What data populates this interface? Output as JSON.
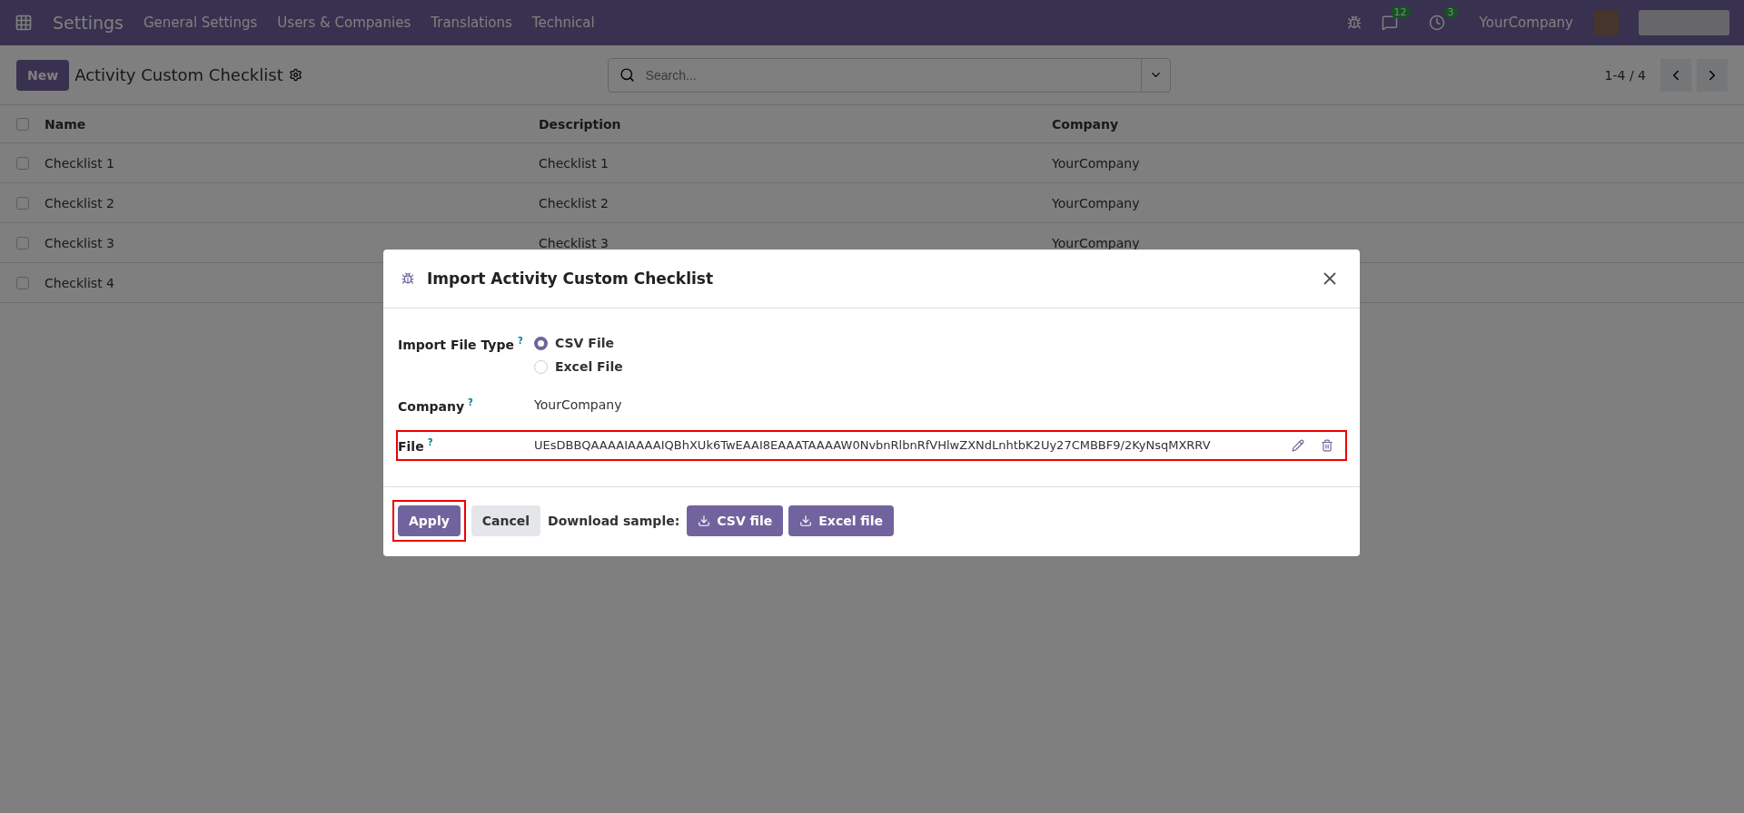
{
  "navbar": {
    "app": "Settings",
    "menu": [
      "General Settings",
      "Users & Companies",
      "Translations",
      "Technical"
    ],
    "messages_count": "12",
    "activities_count": "3",
    "company": "YourCompany"
  },
  "control_panel": {
    "new_button": "New",
    "title": "Activity Custom Checklist",
    "search": {
      "placeholder": "Search..."
    },
    "pager": "1-4 / 4"
  },
  "table": {
    "columns": [
      "Name",
      "Description",
      "Company"
    ],
    "rows": [
      {
        "cells": [
          "Checklist 1",
          "Checklist 1",
          "YourCompany"
        ],
        "checked": false
      },
      {
        "cells": [
          "Checklist 2",
          "Checklist 2",
          "YourCompany"
        ],
        "checked": false
      },
      {
        "cells": [
          "Checklist 3",
          "Checklist 3",
          "YourCompany"
        ],
        "checked": false
      },
      {
        "cells": [
          "Checklist 4"
        ],
        "checked": false
      }
    ],
    "all_checked": false
  },
  "dialog": {
    "title": "Import Activity Custom Checklist",
    "import_type": {
      "label": "Import File Type",
      "help": "?",
      "options": [
        {
          "label": "CSV File",
          "selected": true
        },
        {
          "label": "Excel File",
          "selected": false
        }
      ]
    },
    "company": {
      "label": "Company",
      "help": "?",
      "value": "YourCompany"
    },
    "file": {
      "label": "File",
      "help": "?",
      "value": "UEsDBBQAAAAIAAAAIQBhXUk6TwEAAI8EAAATAAAAW0NvbnRlbnRfVHlwZXNdLnhtbK2Uy27CMBBF9/2KyNsqMXRRV",
      "highlighted": true
    },
    "footer": {
      "apply": {
        "label": "Apply",
        "highlighted": true
      },
      "cancel": "Cancel",
      "download_label": "Download sample:",
      "samples": [
        "CSV file",
        "Excel file"
      ]
    }
  }
}
